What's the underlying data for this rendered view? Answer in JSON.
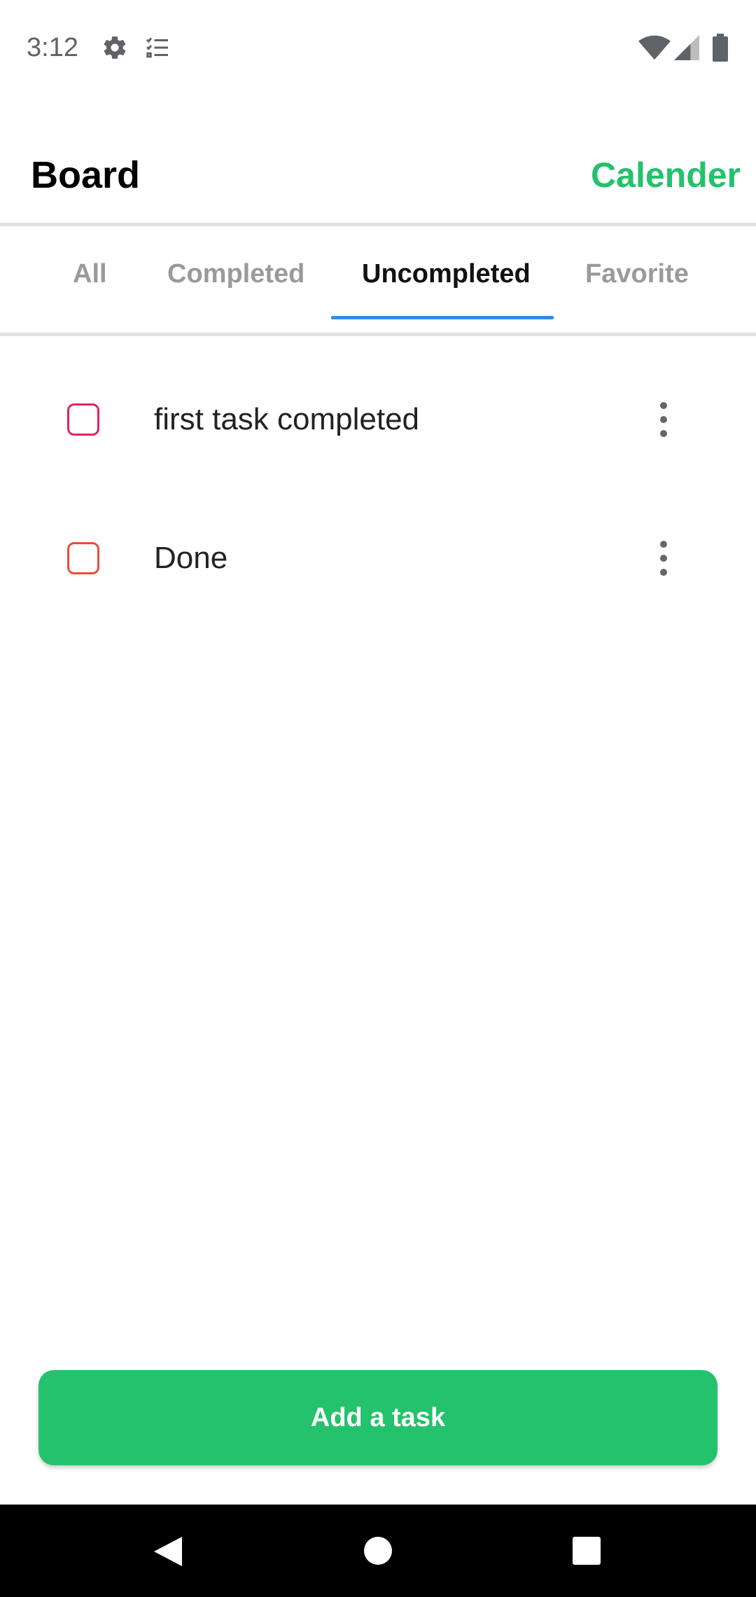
{
  "status_bar": {
    "time": "3:12",
    "icons": [
      "gear-icon",
      "checklist-icon",
      "wifi-icon",
      "signal-icon",
      "battery-icon"
    ]
  },
  "header": {
    "title": "Board",
    "calendar_link": "Calender",
    "accent_color": "#23c26b"
  },
  "tabs": {
    "items": [
      {
        "label": "All",
        "active": false
      },
      {
        "label": "Completed",
        "active": false
      },
      {
        "label": "Uncompleted",
        "active": true
      },
      {
        "label": "Favorite",
        "active": false
      }
    ],
    "indicator_color": "#2e8fe6"
  },
  "tasks": [
    {
      "label": "first task completed",
      "checked": false,
      "checkbox_color": "#e0245e"
    },
    {
      "label": "Done",
      "checked": false,
      "checkbox_color": "#ef4a3a"
    }
  ],
  "add_button": {
    "label": "Add a task",
    "color": "#25c26d"
  },
  "nav_bar": {
    "icons": [
      "back-icon",
      "home-icon",
      "recents-icon"
    ]
  }
}
